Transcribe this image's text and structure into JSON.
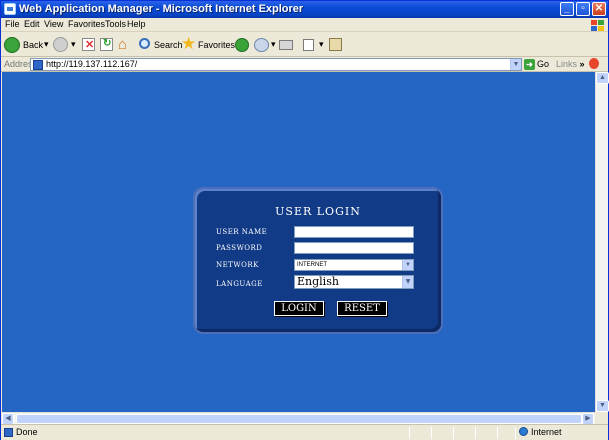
{
  "window": {
    "title": "Web Application Manager - Microsoft Internet Explorer"
  },
  "menu": [
    "File",
    "Edit",
    "View",
    "Favorites",
    "Tools",
    "Help"
  ],
  "toolbar": {
    "back_label": "Back",
    "search_label": "Search",
    "favorites_label": "Favorites"
  },
  "address": {
    "label": "Address",
    "url": "http://119.137.112.167/",
    "go_label": "Go",
    "links_label": "Links"
  },
  "login": {
    "title": "USER LOGIN",
    "username_label": "USER NAME",
    "password_label": "PASSWORD",
    "network_label": "NETWORK",
    "language_label": "LANGUAGE",
    "network_value": "INTERNET",
    "language_value": "English",
    "login_button": "LOGIN",
    "reset_button": "RESET"
  },
  "status": {
    "text": "Done",
    "zone": "Internet"
  }
}
